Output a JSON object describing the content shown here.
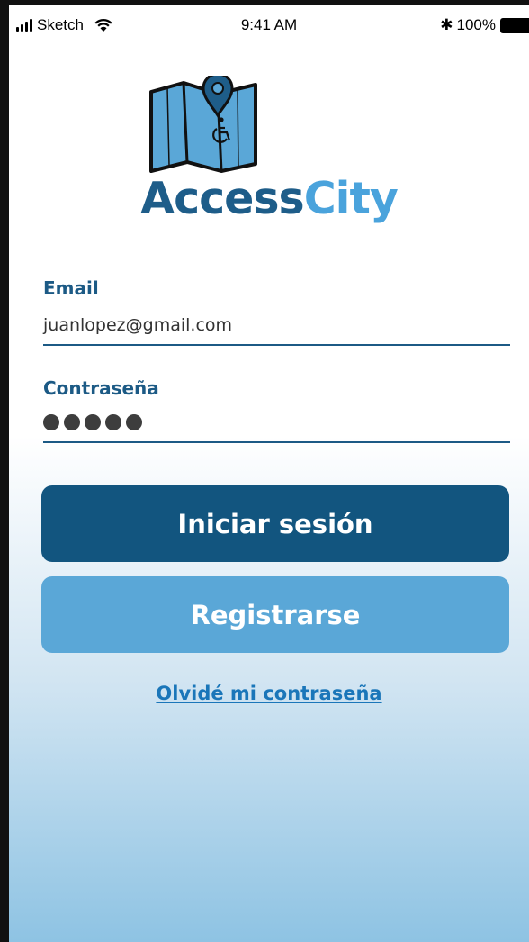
{
  "status_bar": {
    "carrier": "Sketch",
    "time": "9:41 AM",
    "battery": "100%"
  },
  "logo": {
    "brand_part1": "Access",
    "brand_part2": "City"
  },
  "form": {
    "email_label": "Email",
    "email_value": "juanlopez@gmail.com",
    "password_label": "Contraseña",
    "password_length": 5
  },
  "actions": {
    "login_label": "Iniciar sesión",
    "register_label": "Registrarse",
    "forgot_label": "Olvidé mi contraseña"
  },
  "colors": {
    "primary": "#12557f",
    "secondary": "#5aa7d7",
    "brand_dark": "#1e5d89",
    "brand_light": "#4aa3dc",
    "link": "#1a76b9"
  },
  "icons": [
    "cellular-signal-icon",
    "wifi-icon",
    "bluetooth-icon",
    "battery-icon",
    "map-pin-icon",
    "wheelchair-icon"
  ]
}
